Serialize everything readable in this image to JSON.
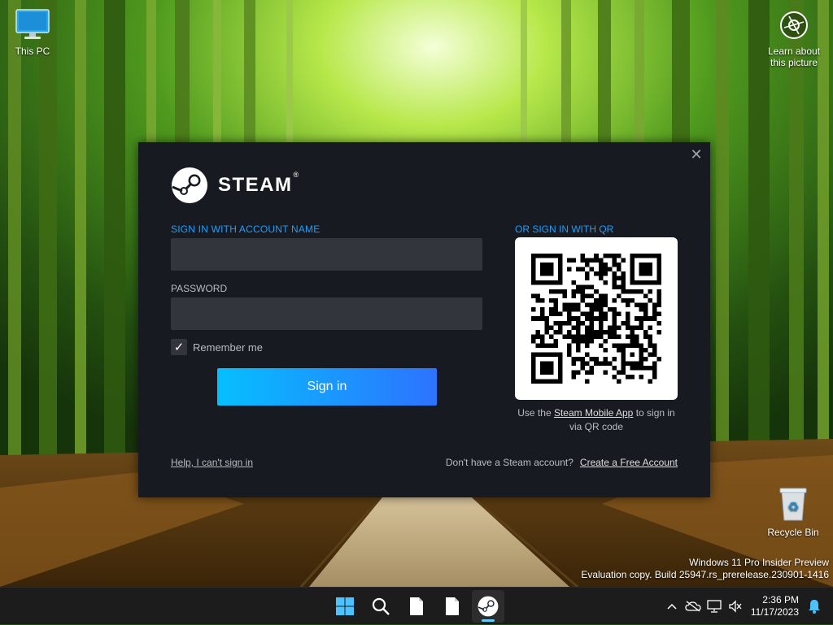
{
  "desktop": {
    "this_pc_label": "This PC",
    "learn_picture_label": "Learn about this picture",
    "recycle_bin_label": "Recycle Bin",
    "watermark_line1": "Windows 11 Pro Insider Preview",
    "watermark_line2": "Evaluation copy. Build 25947.rs_prerelease.230901-1416"
  },
  "steam": {
    "logo_text": "STEAM",
    "logo_mark": "®",
    "close_icon": "close-icon",
    "account_label": "SIGN IN WITH ACCOUNT NAME",
    "account_value": "",
    "password_label": "PASSWORD",
    "password_value": "",
    "remember_label": "Remember me",
    "remember_checked": true,
    "sign_in_label": "Sign in",
    "qr_label": "OR SIGN IN WITH QR",
    "qr_caption_pre": "Use the ",
    "qr_caption_link": "Steam Mobile App",
    "qr_caption_post": " to sign in via QR code",
    "help_link": "Help, I can't sign in",
    "no_account_text": "Don't have a Steam account?",
    "create_account_link": "Create a Free Account",
    "colors": {
      "accent": "#1a9fff",
      "bg": "#181a21",
      "input_bg": "#32353c",
      "btn_start": "#06bfff",
      "btn_end": "#2d73ff"
    }
  },
  "taskbar": {
    "icons": [
      "windows-start-icon",
      "search-icon",
      "file-icon",
      "file-icon",
      "steam-icon"
    ],
    "active": "steam-icon",
    "time": "2:36 PM",
    "date": "11/17/2023",
    "tray_icons": [
      "chevron-up-icon",
      "cloud-off-icon",
      "network-icon",
      "volume-muted-icon",
      "notification-bell-icon"
    ]
  }
}
